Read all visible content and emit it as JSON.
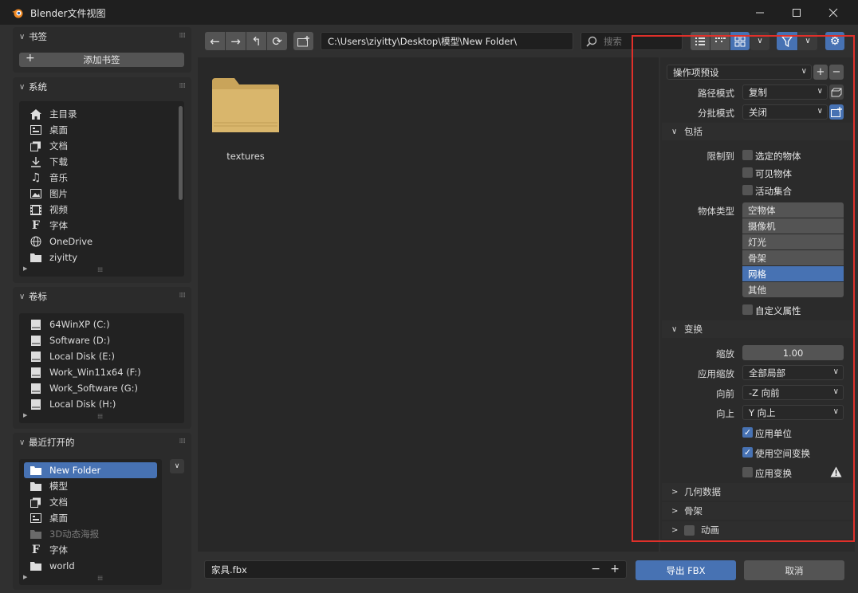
{
  "window": {
    "title": "Blender文件视图"
  },
  "bookmarks": {
    "header": "书签",
    "add_label": "添加书签"
  },
  "system": {
    "header": "系统",
    "items": [
      {
        "label": "主目录",
        "icon": "home-icon"
      },
      {
        "label": "桌面",
        "icon": "desktop-icon"
      },
      {
        "label": "文档",
        "icon": "documents-icon"
      },
      {
        "label": "下载",
        "icon": "download-icon"
      },
      {
        "label": "音乐",
        "icon": "music-icon"
      },
      {
        "label": "图片",
        "icon": "image-icon"
      },
      {
        "label": "视频",
        "icon": "video-icon"
      },
      {
        "label": "字体",
        "icon": "font-icon"
      },
      {
        "label": "OneDrive",
        "icon": "globe-icon"
      },
      {
        "label": "ziyitty",
        "icon": "folder-icon"
      }
    ]
  },
  "volumes": {
    "header": "卷标",
    "items": [
      {
        "label": "64WinXP (C:)"
      },
      {
        "label": "Software (D:)"
      },
      {
        "label": "Local Disk (E:)"
      },
      {
        "label": "Work_Win11x64 (F:)"
      },
      {
        "label": "Work_Software (G:)"
      },
      {
        "label": "Local Disk (H:)"
      }
    ]
  },
  "recent": {
    "header": "最近打开的",
    "items": [
      {
        "label": "New Folder",
        "icon": "folder-icon",
        "selected": true
      },
      {
        "label": "模型",
        "icon": "folder-icon"
      },
      {
        "label": "文档",
        "icon": "documents-icon"
      },
      {
        "label": "桌面",
        "icon": "desktop-icon"
      },
      {
        "label": "3D动态海报",
        "icon": "folder-icon",
        "dim": true
      },
      {
        "label": "字体",
        "icon": "font-icon"
      },
      {
        "label": "world",
        "icon": "folder-icon"
      }
    ]
  },
  "toolbar": {
    "path": "C:\\Users\\ziyitty\\Desktop\\模型\\New Folder\\",
    "search_placeholder": "搜索"
  },
  "files": [
    {
      "name": "textures",
      "type": "folder"
    }
  ],
  "settings": {
    "preset_label": "操作项预设",
    "path_mode_label": "路径模式",
    "path_mode_value": "复制",
    "batch_mode_label": "分批模式",
    "batch_mode_value": "关闭",
    "include": {
      "header": "包括",
      "limit_label": "限制到",
      "limit_options": [
        {
          "label": "选定的物体",
          "checked": false
        },
        {
          "label": "可见物体",
          "checked": false
        },
        {
          "label": "活动集合",
          "checked": false
        }
      ],
      "object_types_label": "物体类型",
      "object_types": [
        {
          "label": "空物体",
          "selected": false
        },
        {
          "label": "摄像机",
          "selected": false
        },
        {
          "label": "灯光",
          "selected": false
        },
        {
          "label": "骨架",
          "selected": false
        },
        {
          "label": "网格",
          "selected": true
        },
        {
          "label": "其他",
          "selected": false
        }
      ],
      "custom_props_label": "自定义属性"
    },
    "transform": {
      "header": "变换",
      "scale_label": "缩放",
      "scale_value": "1.00",
      "apply_scale_label": "应用缩放",
      "apply_scale_value": "全部局部",
      "forward_label": "向前",
      "forward_value": "-Z 向前",
      "up_label": "向上",
      "up_value": "Y 向上",
      "apply_units_label": "应用单位",
      "apply_units_checked": true,
      "space_transform_label": "使用空间变换",
      "space_transform_checked": true,
      "apply_transform_label": "应用变换",
      "apply_transform_checked": false
    },
    "geometry_header": "几何数据",
    "armature_header": "骨架",
    "animation_header": "动画"
  },
  "footer": {
    "filename": "家具.fbx",
    "export_label": "导出 FBX",
    "cancel_label": "取消"
  },
  "colors": {
    "accent": "#4772b3",
    "highlight_box": "#e0302a"
  }
}
